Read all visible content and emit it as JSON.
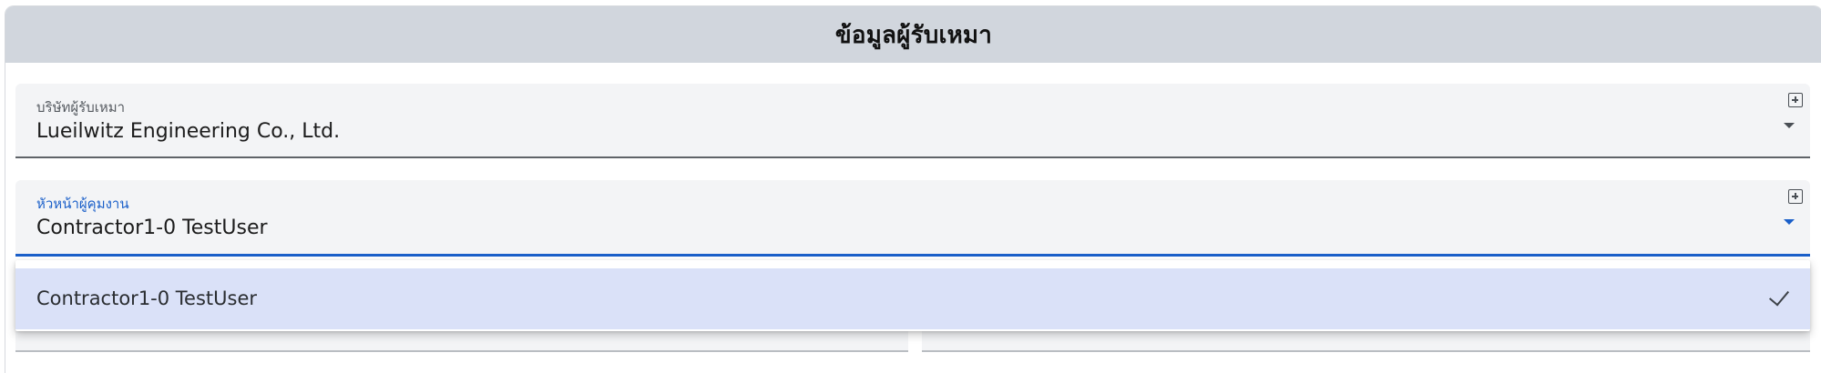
{
  "panel": {
    "title": "ข้อมูลผู้รับเหมา"
  },
  "fields": {
    "contractor_company": {
      "label": "บริษัทผู้รับเหมา",
      "value": "Lueilwitz Engineering Co., Ltd."
    },
    "site_supervisor": {
      "label": "หัวหน้าผู้คุมงาน",
      "value": "Contractor1-0 TestUser"
    }
  },
  "dropdown": {
    "options": [
      {
        "label": "Contractor1-0 TestUser",
        "selected": true
      }
    ]
  },
  "icons": {
    "add": "add-box-icon",
    "caret": "arrow-drop-down-icon",
    "check": "check-icon"
  },
  "colors": {
    "header_bg": "#d1d6dd",
    "field_bg": "#f3f4f6",
    "focus_accent": "#1a5fc9",
    "selected_option_bg": "#dae1f8"
  }
}
